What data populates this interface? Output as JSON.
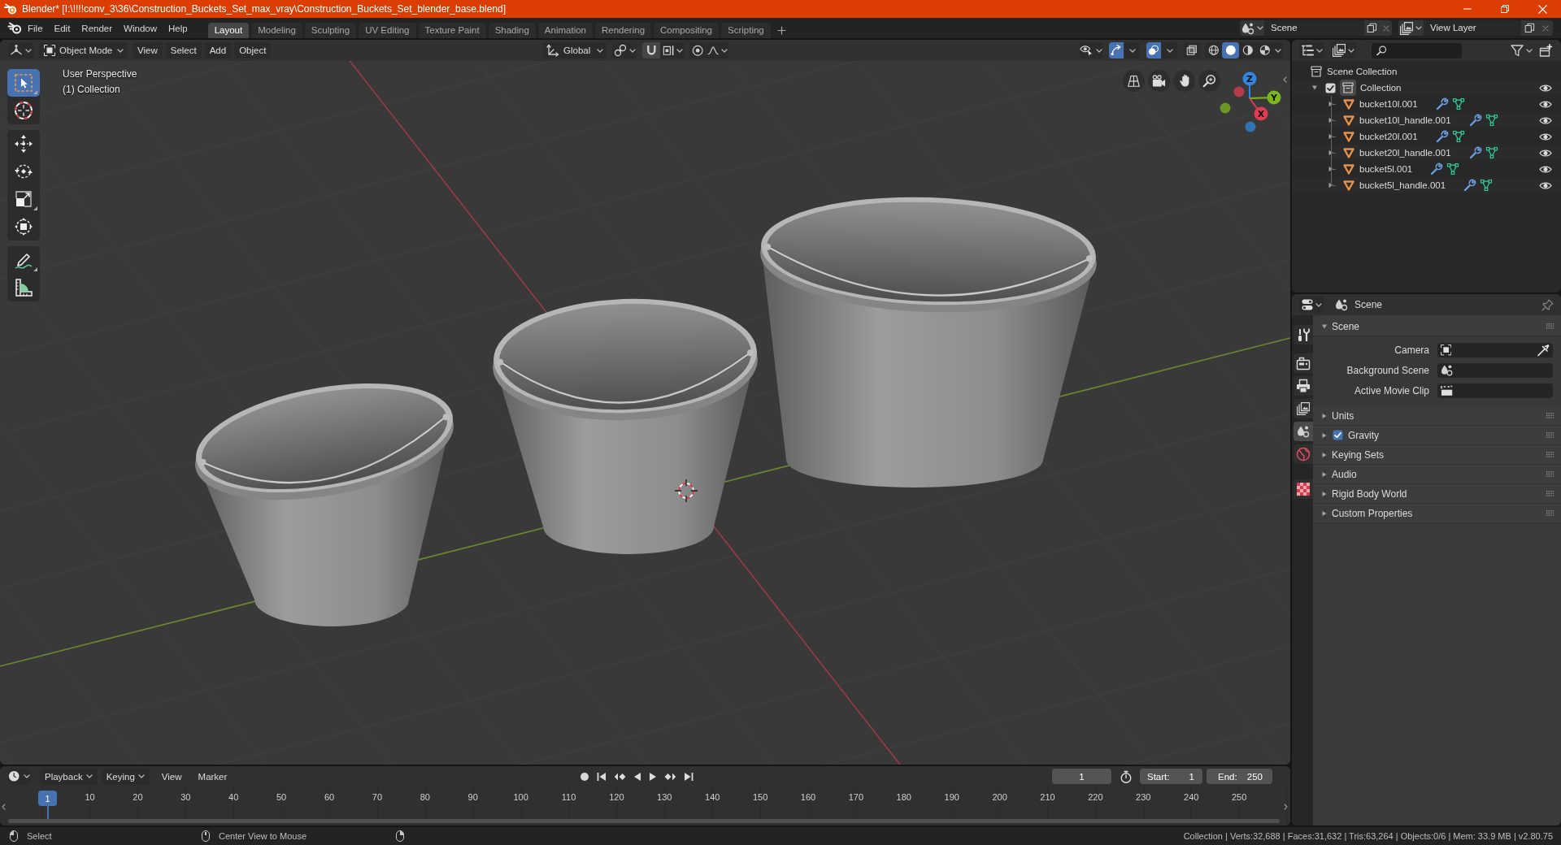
{
  "window": {
    "title": "Blender* [I:\\!!!!conv_3\\36\\Construction_Buckets_Set_max_vray\\Construction_Buckets_Set_blender_base.blend]"
  },
  "menu": [
    "File",
    "Edit",
    "Render",
    "Window",
    "Help"
  ],
  "workspaces": [
    {
      "label": "Layout",
      "selected": true
    },
    {
      "label": "Modeling",
      "selected": false
    },
    {
      "label": "Sculpting",
      "selected": false
    },
    {
      "label": "UV Editing",
      "selected": false
    },
    {
      "label": "Texture Paint",
      "selected": false
    },
    {
      "label": "Shading",
      "selected": false
    },
    {
      "label": "Animation",
      "selected": false
    },
    {
      "label": "Rendering",
      "selected": false
    },
    {
      "label": "Compositing",
      "selected": false
    },
    {
      "label": "Scripting",
      "selected": false
    }
  ],
  "scene_selector": {
    "value": "Scene"
  },
  "view_layer_selector": {
    "value": "View Layer"
  },
  "viewport": {
    "mode": "Object Mode",
    "menus": [
      "View",
      "Select",
      "Add",
      "Object"
    ],
    "orientation": "Global",
    "gizmos_on": true,
    "overlays_on": true,
    "xray_on": false,
    "shading": [
      {
        "kind": "wireframe",
        "selected": false
      },
      {
        "kind": "solid",
        "selected": true
      },
      {
        "kind": "material",
        "selected": false
      },
      {
        "kind": "rendered",
        "selected": false
      }
    ],
    "view_name": "User Perspective",
    "collection_label": "(1) Collection",
    "toolbar": [
      [
        {
          "kind": "select_box",
          "selected": true
        },
        {
          "kind": "cursor",
          "selected": false
        }
      ],
      [
        {
          "kind": "move",
          "selected": false
        },
        {
          "kind": "rotate",
          "selected": false
        },
        {
          "kind": "scale",
          "selected": false
        },
        {
          "kind": "transform",
          "selected": false
        }
      ],
      [
        {
          "kind": "annotate",
          "selected": false
        },
        {
          "kind": "measure",
          "selected": false
        }
      ]
    ],
    "gizmo_axes": [
      {
        "label": "Z",
        "color": "#2f86e0"
      },
      {
        "label": "Y",
        "color": "#7bb61e"
      },
      {
        "label": "X",
        "color": "#e23c52"
      }
    ]
  },
  "outliner": {
    "root": "Scene Collection",
    "collections": [
      {
        "label": "Collection",
        "expanded": true,
        "checked": true,
        "visible": true,
        "children": [
          {
            "label": "bucket10l.001",
            "expanded": false,
            "visible": true
          },
          {
            "label": "bucket10l_handle.001",
            "expanded": false,
            "visible": true
          },
          {
            "label": "bucket20l.001",
            "expanded": false,
            "visible": true
          },
          {
            "label": "bucket20l_handle.001",
            "expanded": false,
            "visible": true
          },
          {
            "label": "bucket5l.001",
            "expanded": false,
            "visible": true
          },
          {
            "label": "bucket5l_handle.001",
            "expanded": false,
            "visible": true
          }
        ]
      }
    ]
  },
  "properties": {
    "context": "Scene",
    "tabs": [
      [
        {
          "kind": "tool",
          "selected": false
        }
      ],
      [
        {
          "kind": "render",
          "selected": false
        },
        {
          "kind": "output",
          "selected": false
        },
        {
          "kind": "view_layer",
          "selected": false
        },
        {
          "kind": "scene",
          "selected": true
        },
        {
          "kind": "world",
          "selected": false
        }
      ],
      [
        {
          "kind": "texture",
          "selected": false
        }
      ]
    ],
    "panels": [
      {
        "title": "Scene",
        "kind": "plain",
        "expanded": true,
        "fields": [
          {
            "label": "Camera",
            "kind": "camera"
          },
          {
            "label": "Background Scene",
            "kind": "scene"
          },
          {
            "label": "Active Movie Clip",
            "kind": "clip"
          }
        ]
      },
      {
        "title": "Units",
        "kind": "plain",
        "expanded": false
      },
      {
        "title": "Gravity",
        "kind": "toggle",
        "checked": true,
        "expanded": false
      },
      {
        "title": "Keying Sets",
        "kind": "plain",
        "expanded": false
      },
      {
        "title": "Audio",
        "kind": "plain",
        "expanded": false
      },
      {
        "title": "Rigid Body World",
        "kind": "plain",
        "expanded": false
      },
      {
        "title": "Custom Properties",
        "kind": "plain",
        "expanded": false
      }
    ]
  },
  "timeline": {
    "menus": [
      {
        "label": "Playback",
        "dropdown": true
      },
      {
        "label": "Keying",
        "dropdown": true
      },
      {
        "label": "View",
        "dropdown": false
      },
      {
        "label": "Marker",
        "dropdown": false
      }
    ],
    "auto_keying": false,
    "current_frame": "1",
    "start_label": "Start:",
    "start": "1",
    "end_label": "End:",
    "end": "250",
    "playhead": "1",
    "ruler": [
      "10",
      "20",
      "30",
      "40",
      "50",
      "60",
      "70",
      "80",
      "90",
      "100",
      "110",
      "120",
      "130",
      "140",
      "150",
      "160",
      "170",
      "180",
      "190",
      "200",
      "210",
      "220",
      "230",
      "240",
      "250"
    ]
  },
  "status_bar": {
    "hints": [
      {
        "kind": "left",
        "label": "Select"
      },
      {
        "kind": "middle",
        "label": "Center View to Mouse"
      },
      {
        "kind": "right"
      }
    ],
    "stats": "Collection | Verts:32,688 | Faces:31,632 | Tris:63,264 | Objects:0/6 | Mem: 33.9 MB | v2.80.75"
  }
}
